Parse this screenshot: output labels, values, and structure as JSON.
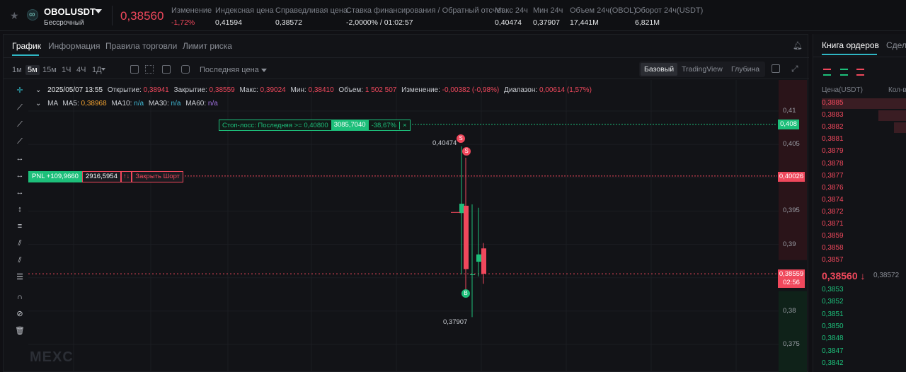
{
  "ticker": {
    "symbol": "OBOLUSDT",
    "contract_type": "Бессрочный",
    "last_price": "0,38560",
    "stats": [
      {
        "label": "Изменение",
        "value": "-1,72%",
        "tone": "neg"
      },
      {
        "label": "Индексная цена",
        "value": "0,41594",
        "tone": ""
      },
      {
        "label": "Справедливая цена",
        "value": "0,38572",
        "tone": ""
      },
      {
        "label": "Ставка финансирования / Обратный отсчет",
        "value": "-2,0000% / 01:02:57",
        "tone": ""
      },
      {
        "label": "Макс 24ч",
        "value": "0,40474",
        "tone": ""
      },
      {
        "label": "Мин 24ч",
        "value": "0,37907",
        "tone": ""
      },
      {
        "label": "Объем 24ч(OBOL)",
        "value": "17,441M",
        "tone": ""
      },
      {
        "label": "Оборот 24ч(USDT)",
        "value": "6,821M",
        "tone": ""
      }
    ]
  },
  "chart_tabs": [
    "График",
    "Информация",
    "Правила торговли",
    "Лимит риска"
  ],
  "timeframes": [
    "1м",
    "5м",
    "15м",
    "1Ч",
    "4Ч",
    "1Д"
  ],
  "price_type": "Последняя цена",
  "view_tabs": [
    "Базовый",
    "TradingView",
    "Глубина"
  ],
  "candle_info": {
    "datetime": "2025/05/07 13:55",
    "open_label": "Открытие:",
    "open": "0,38941",
    "close_label": "Закрытие:",
    "close": "0,38559",
    "high_label": "Макс:",
    "high": "0,39024",
    "low_label": "Мин:",
    "low": "0,38410",
    "volume_label": "Объем:",
    "volume": "1 502 507",
    "change_label": "Изменение:",
    "change": "-0,00382 (-0,98%)",
    "range_label": "Диапазон:",
    "range": "0,00614 (1,57%)"
  },
  "ma_info": {
    "prefix": "MA",
    "ma5_label": "MA5:",
    "ma5": "0,38968",
    "ma10_label": "MA10:",
    "ma10": "n/a",
    "ma30_label": "MA30:",
    "ma30": "n/a",
    "ma60_label": "MA60:",
    "ma60": "n/a"
  },
  "stop_loss": {
    "label": "Стоп-лосс: Последняя >= 0,40800",
    "qty": "3085,7040",
    "pct": "-38,67%",
    "close": "×",
    "axis_tag": "0,408"
  },
  "position": {
    "pnl": "PNL +109,9660",
    "qty": "2916,5954",
    "arrows": "↑↓",
    "close_label": "Закрыть Шорт",
    "axis_tag": "0,40026"
  },
  "current": {
    "price_tag": "0,38559",
    "countdown": "02:56"
  },
  "annotations": {
    "high": "0,40474",
    "low": "0,37907",
    "sell1": "S",
    "sell2": "S",
    "buy": "B"
  },
  "y_axis": {
    "ticks": [
      "0,41",
      "0,405",
      "0,395",
      "0,39",
      "0,38",
      "0,375"
    ],
    "min": 0.3725,
    "max": 0.4125
  },
  "candles": [
    {
      "o": 0.3947,
      "h": 0.4047,
      "l": 0.3855,
      "c": 0.3961,
      "dir": "up"
    },
    {
      "o": 0.3958,
      "h": 0.403,
      "l": 0.3822,
      "c": 0.3863,
      "dir": "down"
    },
    {
      "o": 0.3855,
      "h": 0.396,
      "l": 0.3791,
      "c": 0.3855,
      "dir": "up"
    },
    {
      "o": 0.3874,
      "h": 0.3955,
      "l": 0.3852,
      "c": 0.3885,
      "dir": "up"
    },
    {
      "o": 0.3894,
      "h": 0.3902,
      "l": 0.3841,
      "c": 0.3856,
      "dir": "down"
    }
  ],
  "watermark": "MEXC",
  "orderbook": {
    "tabs": [
      "Книга ордеров",
      "Сделк"
    ],
    "col_price": "Цена(USDT)",
    "col_qty": "Кол-в",
    "asks": [
      "0,3885",
      "0,3883",
      "0,3882",
      "0,3881",
      "0,3879",
      "0,3878",
      "0,3877",
      "0,3876",
      "0,3874",
      "0,3872",
      "0,3871",
      "0,3859",
      "0,3858",
      "0,3857"
    ],
    "mid_price": "0,38560",
    "mid_arrow": "↓",
    "mid_ref": "0,38572",
    "bids": [
      "0,3853",
      "0,3852",
      "0,3851",
      "0,3850",
      "0,3848",
      "0,3847",
      "0,3842"
    ]
  },
  "colors": {
    "up": "#1dbf7a",
    "down": "#f0485c",
    "accent": "#2fb6c4"
  }
}
